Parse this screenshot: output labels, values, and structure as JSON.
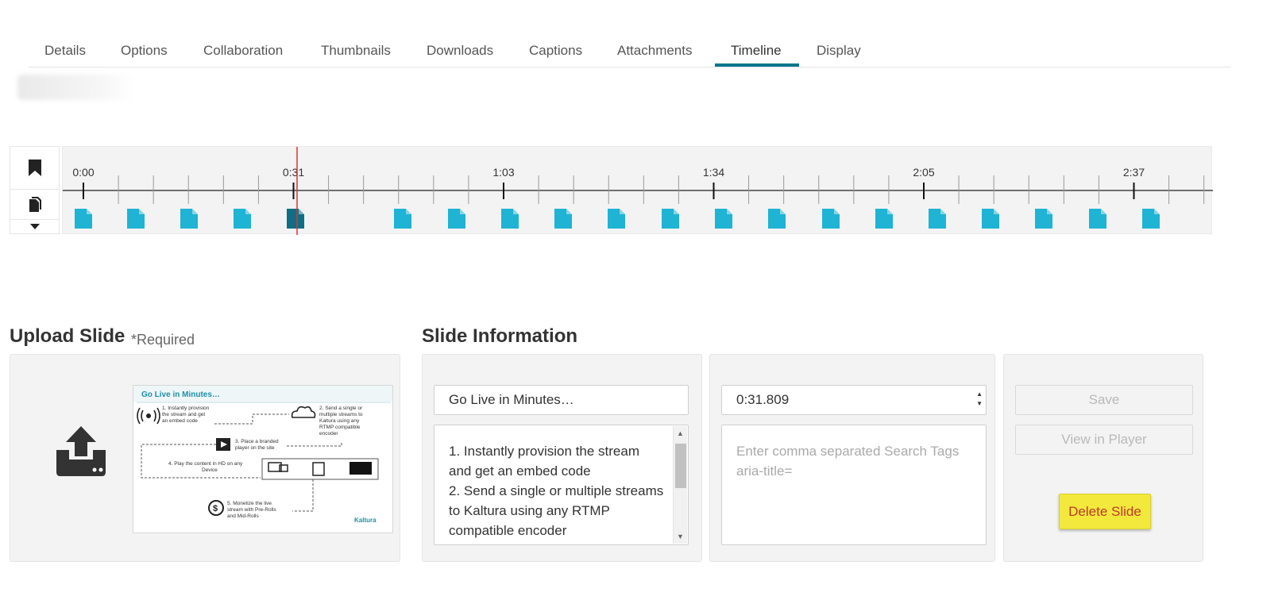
{
  "tabs": [
    {
      "label": "Details"
    },
    {
      "label": "Options"
    },
    {
      "label": "Collaboration"
    },
    {
      "label": "Thumbnails"
    },
    {
      "label": "Downloads"
    },
    {
      "label": "Captions"
    },
    {
      "label": "Attachments"
    },
    {
      "label": "Timeline",
      "active": true
    },
    {
      "label": "Display"
    }
  ],
  "timeline": {
    "time_labels": [
      "0:00",
      "0:31",
      "1:03",
      "1:34",
      "2:05",
      "2:37"
    ],
    "selected_slide_index": 4,
    "slide_count": 21,
    "playhead_label": "0:31",
    "colors": {
      "slide": "#1fb3d4",
      "slide_selected": "#0f6e85",
      "playhead": "#e0302f"
    }
  },
  "upload": {
    "heading": "Upload Slide",
    "required_note": "*Required",
    "icon": "upload-icon"
  },
  "slide_preview": {
    "title": "Go Live in Minutes…",
    "step1": "1. Instantly provision the stream and get an embed code",
    "step2": "2. Send a single or multiple streams to Kaltura using any RTMP compatible encoder",
    "step3": "3. Place a branded player on the site",
    "step4": "4. Play the content in HD on any Device",
    "step5": "5. Monetize the live stream with Pre-Rolls and Mid-Rolls",
    "logo": "Kaltura"
  },
  "slide_info": {
    "heading": "Slide Information",
    "title_value": "Go Live in Minutes…",
    "description_lines": [
      "1. Instantly provision the stream",
      "and get an embed code",
      "2. Send a single or multiple streams",
      "to Kaltura using any RTMP",
      "compatible encoder"
    ],
    "time_value": "0:31.809",
    "tags_placeholder": "Enter comma separated Search Tags aria-title="
  },
  "actions": {
    "save_label": "Save",
    "view_label": "View in Player",
    "delete_label": "Delete Slide"
  }
}
